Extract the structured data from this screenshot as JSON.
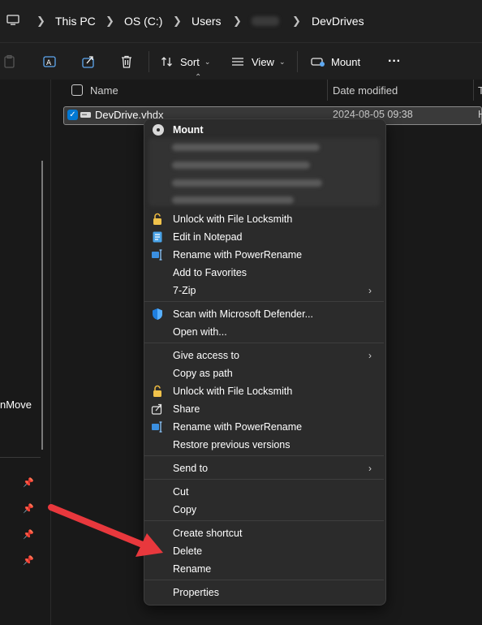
{
  "address": {
    "crumbs": [
      "This PC",
      "OS (C:)",
      "Users",
      "DevDrives"
    ]
  },
  "toolbar": {
    "sort_label": "Sort",
    "view_label": "View",
    "mount_label": "Mount",
    "more_label": "···"
  },
  "columns": {
    "name": "Name",
    "date_modified": "Date modified",
    "type_initial": "T"
  },
  "file": {
    "name": "DevDrive.vhdx",
    "date": "2024-08-05 09:38",
    "type_initial": "H"
  },
  "sidebar": {
    "partial_label": "nMove"
  },
  "menu": {
    "mount": "Mount",
    "unlock1": "Unlock with File Locksmith",
    "edit_notepad": "Edit in Notepad",
    "rename_pr1": "Rename with PowerRename",
    "favorites": "Add to Favorites",
    "zip": "7-Zip",
    "defender": "Scan with Microsoft Defender...",
    "open_with": "Open with...",
    "give_access": "Give access to",
    "copy_path": "Copy as path",
    "unlock2": "Unlock with File Locksmith",
    "share": "Share",
    "rename_pr2": "Rename with PowerRename",
    "restore": "Restore previous versions",
    "send_to": "Send to",
    "cut": "Cut",
    "copy": "Copy",
    "create_shortcut": "Create shortcut",
    "delete": "Delete",
    "rename": "Rename",
    "properties": "Properties"
  },
  "colors": {
    "accent": "#0078d4",
    "arrow": "#e8383d",
    "menu_bg": "#2b2b2b"
  }
}
